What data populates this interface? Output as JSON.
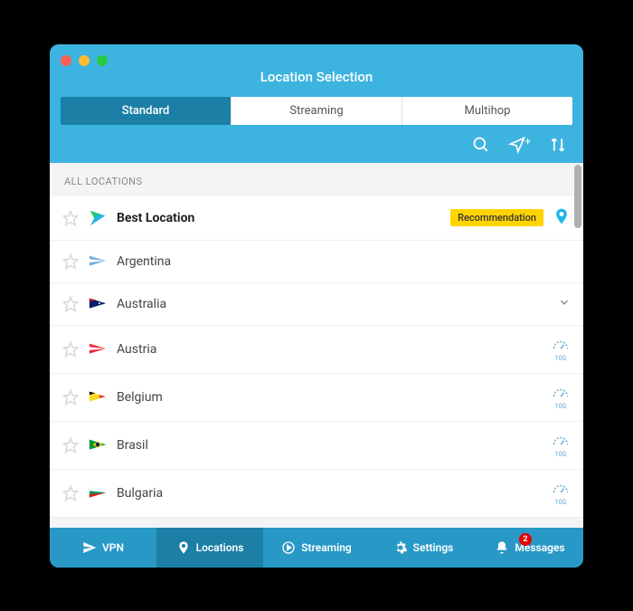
{
  "title": "Location Selection",
  "tabs": [
    {
      "label": "Standard",
      "active": true
    },
    {
      "label": "Streaming",
      "active": false
    },
    {
      "label": "Multihop",
      "active": false
    }
  ],
  "toolbar": {
    "search_icon": "search-icon",
    "nav_icon": "navigate-icon",
    "sort_icon": "sort-icon"
  },
  "section_header": "ALL LOCATIONS",
  "locations": [
    {
      "name": "Best Location",
      "flag": "best",
      "bold": true,
      "recommendation": "Recommendation",
      "pin": true,
      "expandable": false,
      "speed10g": false
    },
    {
      "name": "Argentina",
      "flag": "ar",
      "bold": false,
      "recommendation": null,
      "pin": false,
      "expandable": false,
      "speed10g": false
    },
    {
      "name": "Australia",
      "flag": "au",
      "bold": false,
      "recommendation": null,
      "pin": false,
      "expandable": true,
      "speed10g": false
    },
    {
      "name": "Austria",
      "flag": "at",
      "bold": false,
      "recommendation": null,
      "pin": false,
      "expandable": false,
      "speed10g": true
    },
    {
      "name": "Belgium",
      "flag": "be",
      "bold": false,
      "recommendation": null,
      "pin": false,
      "expandable": false,
      "speed10g": true
    },
    {
      "name": "Brasil",
      "flag": "br",
      "bold": false,
      "recommendation": null,
      "pin": false,
      "expandable": false,
      "speed10g": true
    },
    {
      "name": "Bulgaria",
      "flag": "bg",
      "bold": false,
      "recommendation": null,
      "pin": false,
      "expandable": false,
      "speed10g": true
    }
  ],
  "nav": [
    {
      "label": "VPN",
      "icon": "paper-plane",
      "active": false,
      "badge": null
    },
    {
      "label": "Locations",
      "icon": "location-pin",
      "active": true,
      "badge": null
    },
    {
      "label": "Streaming",
      "icon": "play-circle",
      "active": false,
      "badge": null
    },
    {
      "label": "Settings",
      "icon": "gear",
      "active": false,
      "badge": null
    },
    {
      "label": "Messages",
      "icon": "bell",
      "active": false,
      "badge": "2"
    }
  ],
  "colors": {
    "primary": "#3db3e0",
    "primary_dark": "#1c7fa6",
    "accent_yellow": "#ffd400",
    "accent_red": "#e60000"
  }
}
